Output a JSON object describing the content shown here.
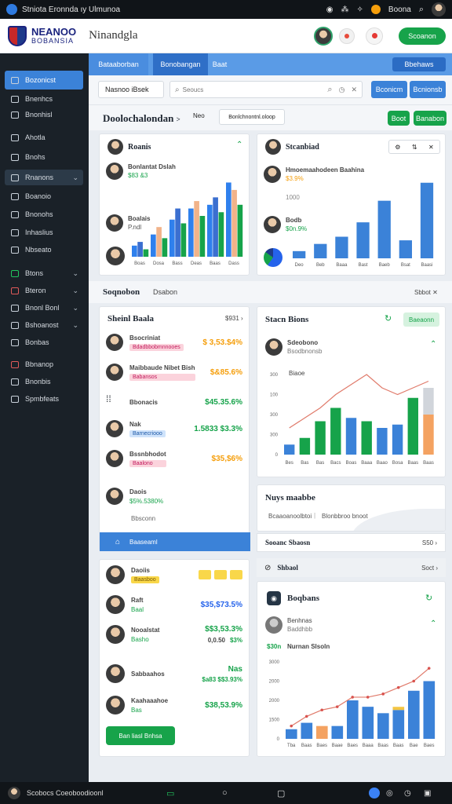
{
  "status_bar": {
    "title": "Stniota Eronnda ıy Ulmunoa",
    "user": "Boona"
  },
  "header": {
    "logo_line1": "NEANOO",
    "logo_line2": "BOBANSIA",
    "app_title": "Ninandgla",
    "primary_button": "Scoanon"
  },
  "sidebar": {
    "items": [
      {
        "label": "Bozonicst",
        "active": true
      },
      {
        "label": "Bnenhcs"
      },
      {
        "label": "Bnonhisl"
      },
      {
        "label": "Ahotla"
      },
      {
        "label": "Bnohs"
      },
      {
        "label": "Rnanons",
        "chevron": true,
        "highlight": true
      },
      {
        "label": "Boanoio"
      },
      {
        "label": "Bnonohs"
      },
      {
        "label": "Inhaslius"
      },
      {
        "label": "Nbseato"
      },
      {
        "label": "Btons",
        "chevron": true
      },
      {
        "label": "Bteron",
        "chevron": true
      },
      {
        "label": "Bnonl Bonl",
        "chevron": true
      },
      {
        "label": "Bshoanost",
        "chevron": true
      },
      {
        "label": "Bonbas"
      },
      {
        "label": "Bbnanop"
      },
      {
        "label": "Bnonbis"
      },
      {
        "label": "Spmbfeats"
      }
    ]
  },
  "tabs": [
    "Bataaborban",
    "Bonobangan",
    "Baat"
  ],
  "tabs_right_button": "Bbehaws",
  "search": {
    "label": "Nasnoo iBsek",
    "placeholder": "Seoucs",
    "btn1": "Bconicm",
    "btn2": "Bcnionsb"
  },
  "dashboard": {
    "title": "Doolochalondan",
    "chip1": "Neo",
    "chip2": "Bonlchnontnl.oloop",
    "btn1": "Boot",
    "btn2": "Banabon"
  },
  "card1": {
    "title": "Roanis",
    "rows": [
      {
        "name": "Bonlantat Dslah",
        "value": "$83 &3"
      },
      {
        "name": "Boalais",
        "value": "P.ndl"
      },
      {
        "name": "",
        "value": ""
      }
    ]
  },
  "card2": {
    "title": "Stcanbiad",
    "rows": [
      {
        "name": "Hmoemaahodeen Baahina",
        "value": "$3.9%"
      },
      {
        "name": "Bodb",
        "value": "$0n.9%"
      }
    ]
  },
  "chart1_data": {
    "type": "bar",
    "categories": [
      "Boas",
      "Dosa",
      "Bass",
      "Deas",
      "Baas",
      "Dass"
    ],
    "series": [
      {
        "values": [
          3,
          6,
          10,
          13,
          14,
          20
        ]
      },
      {
        "values": [
          4,
          8,
          13,
          15,
          16,
          18
        ]
      },
      {
        "values": [
          2,
          5,
          9,
          11,
          12,
          14
        ]
      }
    ],
    "ylim": [
      0,
      22
    ]
  },
  "chart2_data": {
    "type": "bar",
    "categories": [
      "Deo",
      "Beb",
      "Baaa",
      "Bast",
      "Baeb",
      "Bsat",
      "Baasi"
    ],
    "values": [
      2,
      4,
      6,
      10,
      16,
      5,
      21
    ],
    "ylim": [
      0,
      24
    ],
    "y_label": "1000"
  },
  "section": {
    "title": "Soqnobon",
    "tab2": "Dsabon",
    "right": "Sbbot"
  },
  "card3": {
    "title": "Sheinl Baala",
    "right": "$931",
    "rows": [
      {
        "name": "Bsocriniat",
        "tag": "Bdadbbobmnnooes",
        "value": "$ 3,53.$4%",
        "color": "orange"
      },
      {
        "name": "Maibbaude Nibet Bish",
        "tag": "Babansos",
        "value": "$&85.6%",
        "color": "orange"
      },
      {
        "name": "Bbonacis",
        "tag": "",
        "value": "$45.35.6%",
        "color": "green"
      },
      {
        "name": "Nak",
        "tag": "Barnecriooo",
        "value": "1.5833 $3.3%",
        "color": "green"
      },
      {
        "name": "Bssnbhodot",
        "tag": "Baalono",
        "value": "$35,$6%",
        "color": "orange"
      },
      {
        "name": "Daois",
        "tag": "$5%.5380%",
        "value": "",
        "color": "green"
      }
    ],
    "sub": "Bbsconn",
    "footer": "Baaseaml"
  },
  "card4": {
    "title": "Stacn Bions",
    "badge": "Baeaonn",
    "row": {
      "name": "Sdeobono",
      "tag": "Bsodbnonsb"
    },
    "chart_data": {
      "type": "bar+line",
      "y_ticks": [
        "300",
        "100",
        "300",
        "300",
        "0"
      ],
      "y_axis_title": "Biaoe",
      "categories": [
        "Bes",
        "Bas",
        "Bas",
        "Bacs",
        "Boas",
        "Baaa",
        "Baao",
        "Bosa",
        "Baas",
        "Baas"
      ],
      "bars": [
        3,
        5,
        10,
        14,
        11,
        10,
        8,
        9,
        17,
        12
      ],
      "line": [
        8,
        11,
        14,
        18,
        21,
        24,
        20,
        18,
        20,
        22
      ]
    }
  },
  "card5": {
    "title": "Nuys maabbe",
    "left": "Bcaaoanoolbtoi",
    "right": "Blonbbroo bnoot"
  },
  "strip1": {
    "label": "Sooanc Sbaosn",
    "value": "S50"
  },
  "strip2": {
    "label": "Shbaol",
    "value": "Soct"
  },
  "card6": {
    "title": "Daoiis",
    "rows": [
      {
        "name": "Daoiis",
        "tag": "Baasboo",
        "value": "",
        "color": "orange"
      },
      {
        "name": "Raft",
        "tag": "Baal",
        "value": "$35,$73.5%",
        "color": "blue"
      },
      {
        "name": "Nooalstat",
        "tag": "Basho",
        "value": "$$3,53.3%",
        "color": "green"
      },
      {
        "name": "Sabbaahos",
        "tag": "",
        "value": "Nas",
        "color": "green"
      },
      {
        "name": "Kaahaaahoe",
        "tag": "Bas",
        "value": "$38,53.9%",
        "color": "green"
      }
    ],
    "extra_values": [
      "0,0.50",
      "$3%",
      "$a83 $$3.93%",
      "$33,53.3%"
    ],
    "button": "Ban liasl Bnhsa"
  },
  "card7": {
    "title": "Boqbans",
    "row": {
      "name": "Benhnas",
      "tag": "Baddhbb"
    },
    "sub": "$30n",
    "sub2": "Nurnan Slsoln",
    "chart_data": {
      "type": "bar+line",
      "y_ticks": [
        "3000",
        "2000",
        "2000",
        "1500",
        "0"
      ],
      "categories": [
        "Tba",
        "Baas",
        "Baes",
        "Baae",
        "Baes",
        "Baaa",
        "Baas",
        "Baas",
        "Bae",
        "Baes"
      ],
      "bars": [
        3,
        5,
        4,
        4,
        12,
        10,
        8,
        9,
        15,
        18
      ],
      "bar_colors": [
        "blue",
        "blue",
        "orange",
        "blue",
        "blue",
        "blue",
        "blue",
        "blue",
        "blue",
        "blue"
      ],
      "line": [
        4,
        7,
        9,
        10,
        13,
        13,
        14,
        16,
        18,
        22
      ]
    }
  },
  "bottom_bar": {
    "label": "Scobocs Coeoboodioonl"
  },
  "colors": {
    "primary_blue": "#3b82d8",
    "green": "#17a34a",
    "sidebar": "#1a2128"
  }
}
